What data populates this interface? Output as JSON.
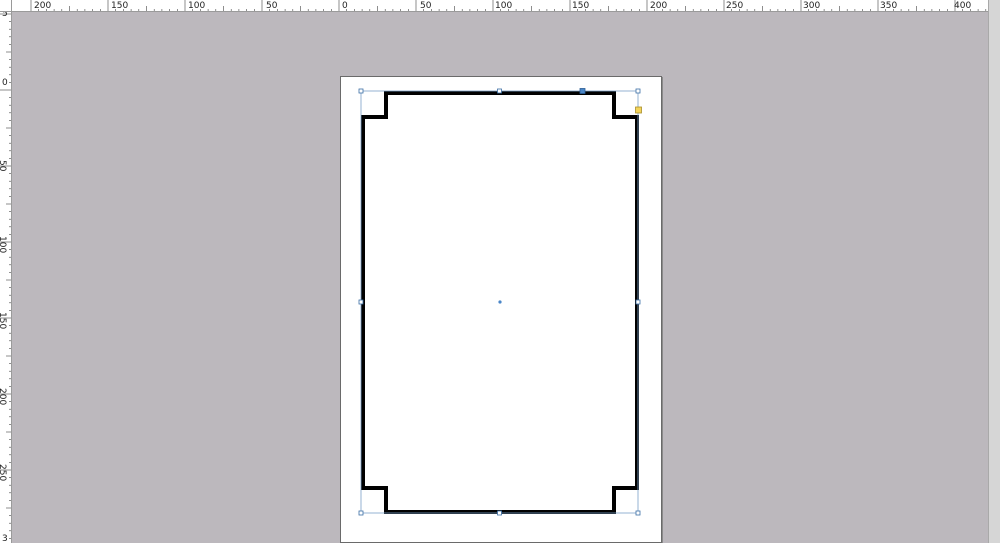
{
  "ruler_top": {
    "labels": [
      "200",
      "150",
      "100",
      "50",
      "0",
      "50",
      "100",
      "150",
      "200",
      "250",
      "300",
      "350",
      "400"
    ]
  },
  "ruler_left": {
    "labels": [
      "5",
      "0",
      "50",
      "100",
      "150",
      "200",
      "250",
      "3"
    ]
  },
  "document": {
    "shape": "frame-with-notched-corners",
    "stroke_color": "#000000",
    "selection_color": "#3b6ea5",
    "active_handle_color": "#4a86c8",
    "corner_handle_color": "#f2d35a"
  },
  "colors": {
    "canvas_bg": "#bcb8bd",
    "page_bg": "#ffffff",
    "ruler_bg": "#ffffff"
  }
}
